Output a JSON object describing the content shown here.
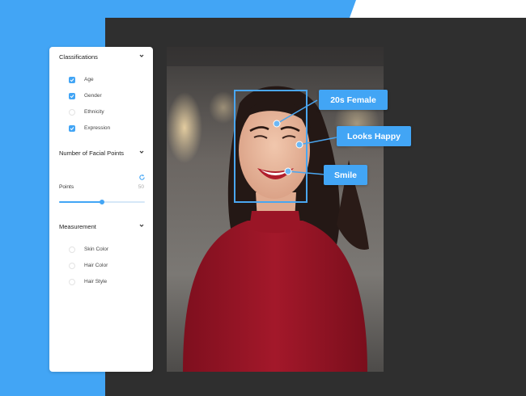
{
  "sidebar": {
    "classifications": {
      "title": "Classifications",
      "options": [
        {
          "label": "Age",
          "checked": true
        },
        {
          "label": "Gender",
          "checked": true
        },
        {
          "label": "Ethnicity",
          "checked": false
        },
        {
          "label": "Expression",
          "checked": true
        }
      ]
    },
    "facial_points": {
      "title": "Number of Facial Points",
      "points_label": "Points",
      "points_value": "50",
      "slider_fraction": 0.5
    },
    "measurement": {
      "title": "Measurement",
      "options": [
        {
          "label": "Skin Color",
          "checked": false
        },
        {
          "label": "Hair Color",
          "checked": false
        },
        {
          "label": "Hair Style",
          "checked": false
        }
      ]
    }
  },
  "annotations": {
    "age_gender": "20s Female",
    "expression": "Looks Happy",
    "feature": "Smile"
  },
  "colors": {
    "accent": "#42a5f5",
    "dark_panel": "#2f2f2f",
    "shirt": "#a3182a"
  }
}
